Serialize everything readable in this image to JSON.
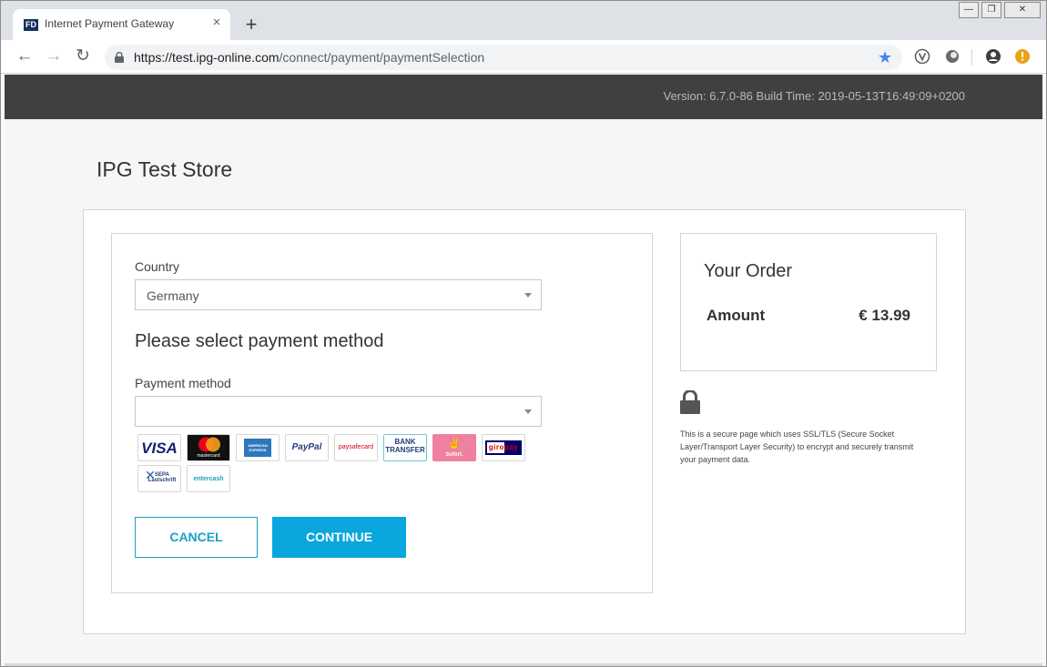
{
  "browser": {
    "tab_favicon": "FD",
    "tab_title": "Internet Payment Gateway",
    "new_tab_symbol": "+",
    "close_symbol": "×",
    "window_controls": [
      "—",
      "❐",
      "✕"
    ],
    "url_host": "https://test.ipg-online.com",
    "url_path": "/connect/payment/paymentSelection",
    "icons": [
      "back-icon",
      "forward-icon",
      "reload-icon",
      "lock-icon",
      "bookmark-star-icon",
      "extension-v-icon",
      "extension-circle-icon",
      "profile-icon",
      "update-alert-icon"
    ]
  },
  "header": {
    "version": "Version: 6.7.0-86 Build Time: 2019-05-13T16:49:09+0200"
  },
  "store": {
    "title": "IPG Test Store"
  },
  "form": {
    "country_label": "Country",
    "country_value": "Germany",
    "heading": "Please select payment method",
    "payment_label": "Payment method",
    "payment_value": "",
    "methods": [
      {
        "name": "visa",
        "label": "VISA"
      },
      {
        "name": "mastercard",
        "label": "mastercard"
      },
      {
        "name": "amex",
        "label": "AMERICAN EXPRESS"
      },
      {
        "name": "paypal",
        "label": "PayPal"
      },
      {
        "name": "paysafecard",
        "label": "paysafecard"
      },
      {
        "name": "bank-transfer",
        "label": "BANK TRANSFER"
      },
      {
        "name": "sofort",
        "label": "Sofort."
      },
      {
        "name": "giropay",
        "label": "giropay"
      },
      {
        "name": "sepa",
        "label": "SEPA Lastschrift"
      },
      {
        "name": "entercash",
        "label": "entercash"
      }
    ],
    "cancel_label": "CANCEL",
    "continue_label": "CONTINUE"
  },
  "order": {
    "title": "Your Order",
    "amount_label": "Amount",
    "amount_value": "€ 13.99"
  },
  "secure_note": "This is a secure page which uses SSL/TLS (Secure Socket Layer/Transport Layer Security) to encrypt and securely transmit your payment data.",
  "colors": {
    "accent": "#0aa6de",
    "header_bg": "#404040",
    "page_bg": "#f6f6f6"
  }
}
